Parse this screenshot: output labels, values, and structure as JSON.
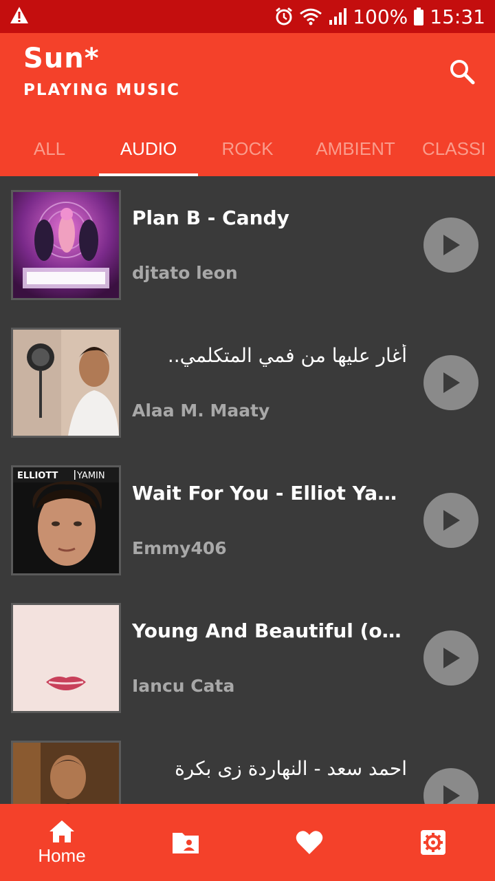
{
  "status_bar": {
    "battery": "100%",
    "time": "15:31"
  },
  "app": {
    "title": "Sun*",
    "subtitle": "PLAYING MUSIC"
  },
  "tabs": [
    {
      "label": "ALL"
    },
    {
      "label": "AUDIO"
    },
    {
      "label": "ROCK"
    },
    {
      "label": "AMBIENT"
    },
    {
      "label": "CLASSI"
    }
  ],
  "tracks": [
    {
      "title": "Plan B - Candy",
      "artist": "djtato leon"
    },
    {
      "title": "أغار عليها من فمي المتكلمي..",
      "artist": "Alaa M. Maaty"
    },
    {
      "title": "Wait For You - Elliot Yamin",
      "artist": "Emmy406",
      "cover_text_left": "ELLIOTT",
      "cover_text_right": "YAMIN"
    },
    {
      "title": "Young And Beautiful (os...",
      "artist": "Iancu Cata"
    },
    {
      "title": "احمد سعد - النهاردة زى بكرة",
      "artist": ""
    }
  ],
  "bottom_nav": {
    "home_label": "Home"
  },
  "colors": {
    "primary": "#f4412a",
    "status": "#c40e0e",
    "background": "#3a3a3a"
  }
}
